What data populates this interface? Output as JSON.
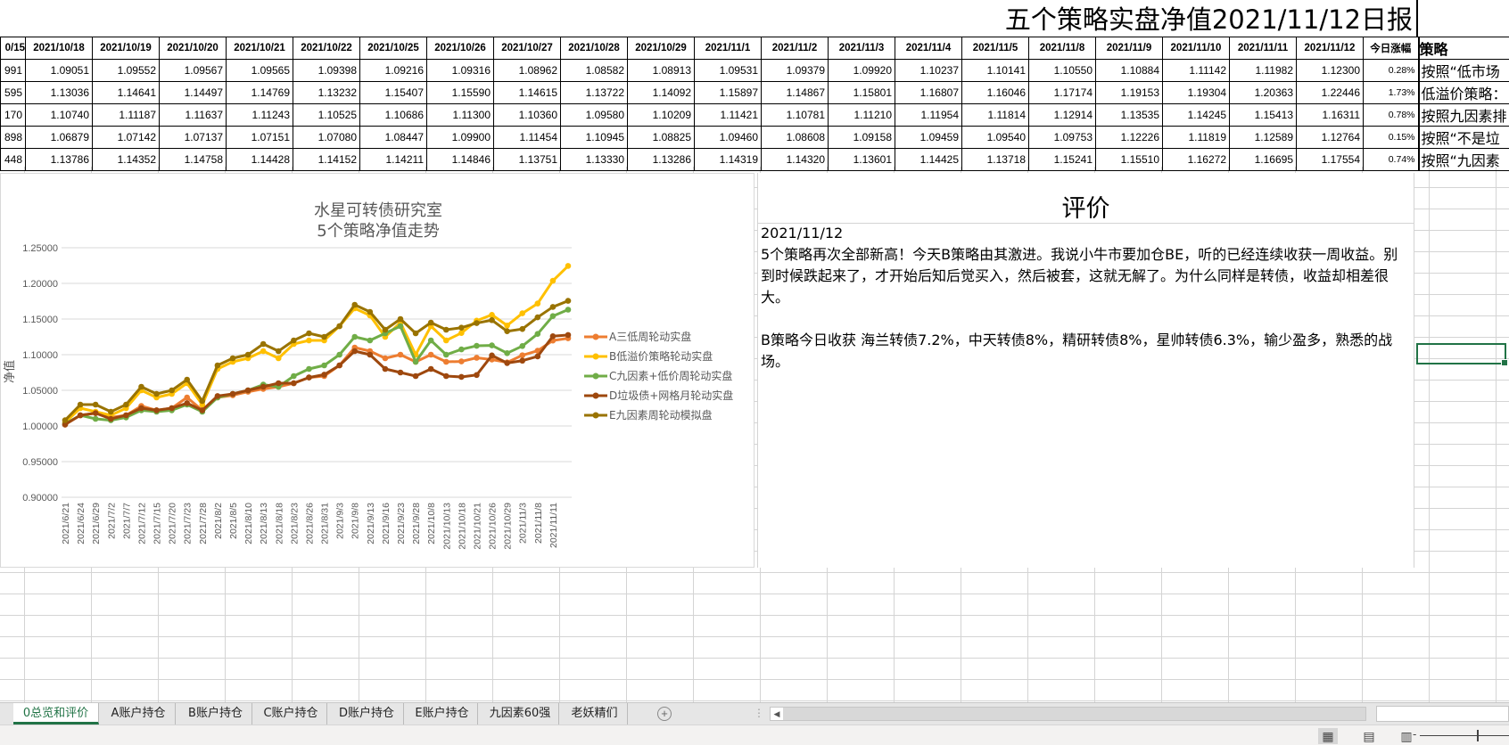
{
  "report_title": "五个策略实盘净值2021/11/12日报",
  "table": {
    "headers": [
      "0/15",
      "2021/10/18",
      "2021/10/19",
      "2021/10/20",
      "2021/10/21",
      "2021/10/22",
      "2021/10/25",
      "2021/10/26",
      "2021/10/27",
      "2021/10/28",
      "2021/10/29",
      "2021/11/1",
      "2021/11/2",
      "2021/11/3",
      "2021/11/4",
      "2021/11/5",
      "2021/11/8",
      "2021/11/9",
      "2021/11/10",
      "2021/11/11",
      "2021/11/12",
      "今日涨幅",
      "策略"
    ],
    "rows": [
      {
        "cells": [
          "991",
          "1.09051",
          "1.09552",
          "1.09567",
          "1.09565",
          "1.09398",
          "1.09216",
          "1.09316",
          "1.08962",
          "1.08582",
          "1.08913",
          "1.09531",
          "1.09379",
          "1.09920",
          "1.10237",
          "1.10141",
          "1.10550",
          "1.10884",
          "1.11142",
          "1.11982",
          "1.12300"
        ],
        "change": "0.28%",
        "strategy": "按照“低市场"
      },
      {
        "cells": [
          "595",
          "1.13036",
          "1.14641",
          "1.14497",
          "1.14769",
          "1.13232",
          "1.15407",
          "1.15590",
          "1.14615",
          "1.13722",
          "1.14092",
          "1.15897",
          "1.14867",
          "1.15801",
          "1.16807",
          "1.16046",
          "1.17174",
          "1.19153",
          "1.19304",
          "1.20363",
          "1.22446"
        ],
        "change": "1.73%",
        "strategy": "低溢价策略："
      },
      {
        "cells": [
          "170",
          "1.10740",
          "1.11187",
          "1.11637",
          "1.11243",
          "1.10525",
          "1.10686",
          "1.11300",
          "1.10360",
          "1.09580",
          "1.10209",
          "1.11421",
          "1.10781",
          "1.11210",
          "1.11954",
          "1.11814",
          "1.12914",
          "1.13535",
          "1.14245",
          "1.15413",
          "1.16311"
        ],
        "change": "0.78%",
        "strategy": "按照九因素排"
      },
      {
        "cells": [
          "898",
          "1.06879",
          "1.07142",
          "1.07137",
          "1.07151",
          "1.07080",
          "1.08447",
          "1.09900",
          "1.11454",
          "1.10945",
          "1.08825",
          "1.09460",
          "1.08608",
          "1.09158",
          "1.09459",
          "1.09540",
          "1.09753",
          "1.12226",
          "1.11819",
          "1.12589",
          "1.12764"
        ],
        "change": "0.15%",
        "strategy": "按照“不是垃"
      },
      {
        "cells": [
          "448",
          "1.13786",
          "1.14352",
          "1.14758",
          "1.14428",
          "1.14152",
          "1.14211",
          "1.14846",
          "1.13751",
          "1.13330",
          "1.13286",
          "1.14319",
          "1.14320",
          "1.13601",
          "1.14425",
          "1.13718",
          "1.15241",
          "1.15510",
          "1.16272",
          "1.16695",
          "1.17554"
        ],
        "change": "0.74%",
        "strategy": "按照“九因素"
      }
    ]
  },
  "chart_data": {
    "type": "line",
    "title": "水星可转债研究室",
    "subtitle": "5个策略净值走势",
    "xlabel": "",
    "ylabel": "净值",
    "ylim": [
      0.9,
      1.25
    ],
    "yticks": [
      "1.25000",
      "1.20000",
      "1.15000",
      "1.10000",
      "1.05000",
      "1.00000",
      "0.95000",
      "0.90000"
    ],
    "grid": true,
    "legend_position": "right",
    "x": [
      "2021/6/21",
      "2021/6/24",
      "2021/6/29",
      "2021/7/2",
      "2021/7/7",
      "2021/7/12",
      "2021/7/15",
      "2021/7/20",
      "2021/7/23",
      "2021/7/28",
      "2021/8/2",
      "2021/8/5",
      "2021/8/10",
      "2021/8/13",
      "2021/8/18",
      "2021/8/23",
      "2021/8/26",
      "2021/8/31",
      "2021/9/3",
      "2021/9/8",
      "2021/9/13",
      "2021/9/16",
      "2021/9/23",
      "2021/9/28",
      "2021/10/8",
      "2021/10/13",
      "2021/10/18",
      "2021/10/21",
      "2021/10/26",
      "2021/10/29",
      "2021/11/3",
      "2021/11/8",
      "2021/11/11",
      "2021/11/12"
    ],
    "xtick_labels": [
      "2021/6/21",
      "2021/6/24",
      "2021/6/29",
      "2021/7/2",
      "2021/7/7",
      "2021/7/12",
      "2021/7/15",
      "2021/7/20",
      "2021/7/23",
      "2021/7/28",
      "2021/8/2",
      "2021/8/5",
      "2021/8/10",
      "2021/8/13",
      "2021/8/18",
      "2021/8/23",
      "2021/8/26",
      "2021/8/31",
      "2021/9/3",
      "2021/9/8",
      "2021/9/13",
      "2021/9/16",
      "2021/9/23",
      "2021/9/28",
      "2021/10/8",
      "2021/10/13",
      "2021/10/18",
      "2021/10/21",
      "2021/10/26",
      "2021/10/29",
      "2021/11/3",
      "2021/11/8",
      "2021/11/11"
    ],
    "series": [
      {
        "name": "A三低周轮动实盘",
        "color": "#ED7D31",
        "values": [
          1.002,
          1.015,
          1.018,
          1.012,
          1.015,
          1.028,
          1.022,
          1.025,
          1.04,
          1.022,
          1.04,
          1.043,
          1.048,
          1.052,
          1.055,
          1.06,
          1.068,
          1.07,
          1.085,
          1.11,
          1.105,
          1.095,
          1.1,
          1.09,
          1.1,
          1.09,
          1.09051,
          1.09565,
          1.09316,
          1.08913,
          1.0992,
          1.1055,
          1.11982,
          1.123
        ]
      },
      {
        "name": "B低溢价策略轮动实盘",
        "color": "#FFC000",
        "values": [
          1.005,
          1.025,
          1.02,
          1.015,
          1.025,
          1.05,
          1.04,
          1.045,
          1.06,
          1.03,
          1.08,
          1.09,
          1.095,
          1.105,
          1.095,
          1.115,
          1.12,
          1.12,
          1.14,
          1.165,
          1.155,
          1.125,
          1.145,
          1.1,
          1.14,
          1.12,
          1.13036,
          1.14769,
          1.1559,
          1.14092,
          1.15801,
          1.17174,
          1.20363,
          1.22446
        ]
      },
      {
        "name": "C九因素+低价周轮动实盘",
        "color": "#70AD47",
        "values": [
          1.003,
          1.015,
          1.01,
          1.008,
          1.012,
          1.022,
          1.02,
          1.022,
          1.03,
          1.02,
          1.04,
          1.045,
          1.05,
          1.058,
          1.055,
          1.07,
          1.08,
          1.085,
          1.1,
          1.125,
          1.12,
          1.13,
          1.14,
          1.09,
          1.12,
          1.1,
          1.1074,
          1.11243,
          1.113,
          1.10209,
          1.1121,
          1.12914,
          1.15413,
          1.16311
        ]
      },
      {
        "name": "D垃圾债+网格月轮动实盘",
        "color": "#9E480E",
        "values": [
          1.002,
          1.015,
          1.018,
          1.01,
          1.015,
          1.025,
          1.022,
          1.025,
          1.032,
          1.022,
          1.042,
          1.045,
          1.05,
          1.055,
          1.06,
          1.06,
          1.068,
          1.072,
          1.085,
          1.105,
          1.1,
          1.08,
          1.075,
          1.07,
          1.08,
          1.07,
          1.06879,
          1.07151,
          1.099,
          1.08825,
          1.09158,
          1.09753,
          1.12589,
          1.12764
        ]
      },
      {
        "name": "E九因素周轮动模拟盘",
        "color": "#997300",
        "values": [
          1.008,
          1.03,
          1.03,
          1.02,
          1.03,
          1.055,
          1.045,
          1.05,
          1.065,
          1.035,
          1.085,
          1.095,
          1.1,
          1.115,
          1.105,
          1.12,
          1.13,
          1.125,
          1.14,
          1.17,
          1.16,
          1.135,
          1.15,
          1.13,
          1.145,
          1.135,
          1.13786,
          1.14428,
          1.14846,
          1.13286,
          1.13601,
          1.15241,
          1.16695,
          1.17554
        ]
      }
    ]
  },
  "review": {
    "title": "评价",
    "date": "2021/11/12",
    "paragraph1": "5个策略再次全部新高！今天B策略由其激进。我说小牛市要加仓BE，听的已经连续收获一周收益。别到时候跌起来了，才开始后知后觉买入，然后被套，这就无解了。为什么同样是转债，收益却相差很大。",
    "paragraph2": "B策略今日收获 海兰转债7.2%，中天转债8%，精研转债8%，星帅转债6.3%，输少盈多，熟悉的战场。"
  },
  "sheet_tabs": [
    "0总览和评价",
    "A账户持仓",
    "B账户持仓",
    "C账户持仓",
    "D账户持仓",
    "E账户持仓",
    "九因素60强",
    "老妖精们"
  ],
  "active_tab": "0总览和评价",
  "add_sheet_icon": "plus-circle-icon"
}
